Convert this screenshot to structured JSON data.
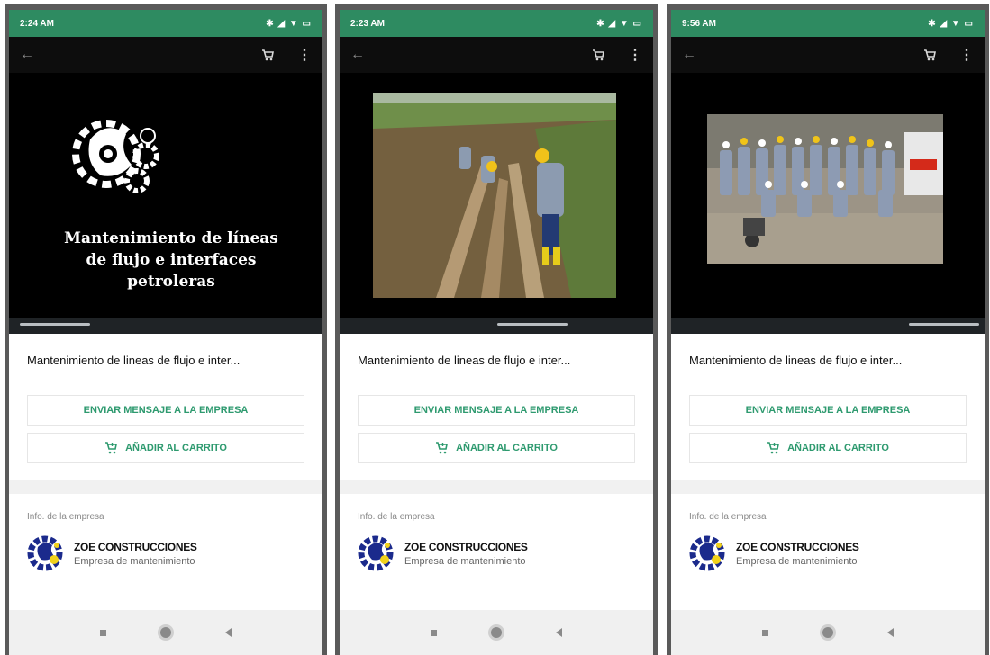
{
  "phones": [
    {
      "status_time": "2:24 AM",
      "status_right": "✱ ◢ ▼ ▭",
      "slide_title": "Mantenimiento de líneas de flujo e interfaces petroleras"
    },
    {
      "status_time": "2:23 AM",
      "status_right": "✱ ◢ ▼ ▭"
    },
    {
      "status_time": "9:56 AM",
      "status_right": "✱ ◢ ▼ ▭"
    }
  ],
  "product": {
    "title": "Mantenimiento de lineas de flujo e inter..."
  },
  "buttons": {
    "message": "ENVIAR MENSAJE A LA EMPRESA",
    "add_cart": "AÑADIR AL CARRITO"
  },
  "company": {
    "section_label": "Info. de la empresa",
    "name": "ZOE CONSTRUCCIONES",
    "description": "Empresa de mantenimiento"
  },
  "icons": {
    "back": "arrow-left-icon",
    "cart": "cart-icon",
    "menu": "more-vert-icon"
  },
  "colors": {
    "status_bar": "#2e8b61",
    "accent": "#2e9a6f",
    "toolbar": "#0d0d0d"
  }
}
